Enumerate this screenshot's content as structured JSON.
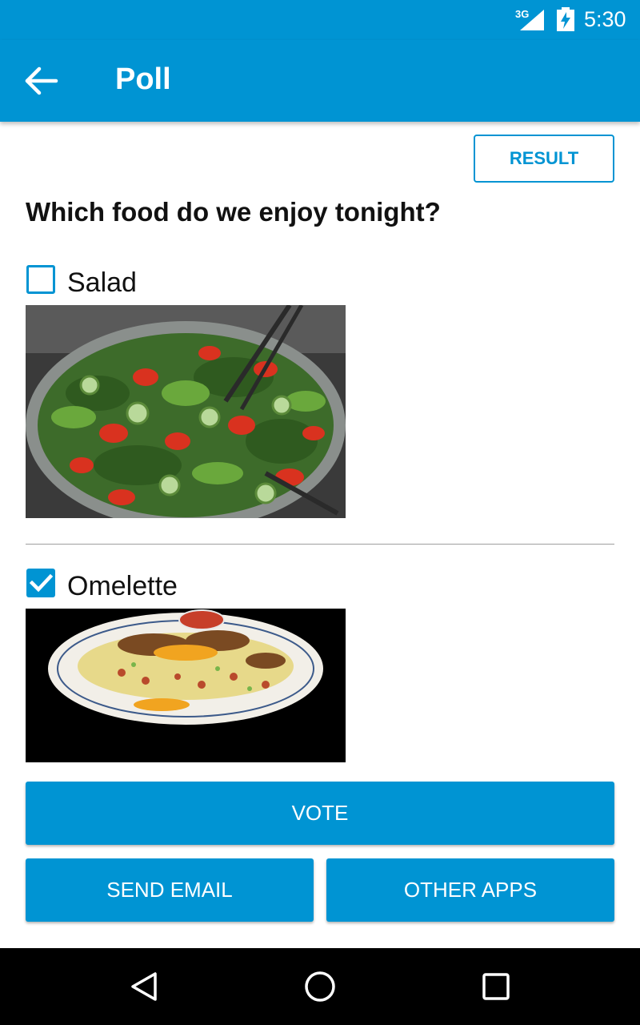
{
  "status_bar": {
    "network": "3G",
    "time": "5:30"
  },
  "app_bar": {
    "title": "Poll",
    "back_icon": "arrow-left-icon"
  },
  "result_button": "RESULT",
  "question": "Which food do we enjoy tonight?",
  "options": [
    {
      "label": "Salad",
      "checked": false,
      "image": "salad-photo"
    },
    {
      "label": "Omelette",
      "checked": true,
      "image": "omelette-photo"
    }
  ],
  "buttons": {
    "vote": "VOTE",
    "send_email": "SEND EMAIL",
    "other_apps": "OTHER APPS"
  },
  "nav_icons": [
    "back-triangle-icon",
    "home-circle-icon",
    "recents-square-icon"
  ],
  "colors": {
    "accent": "#0094d3",
    "nav": "#000000",
    "background": "#ffffff"
  }
}
